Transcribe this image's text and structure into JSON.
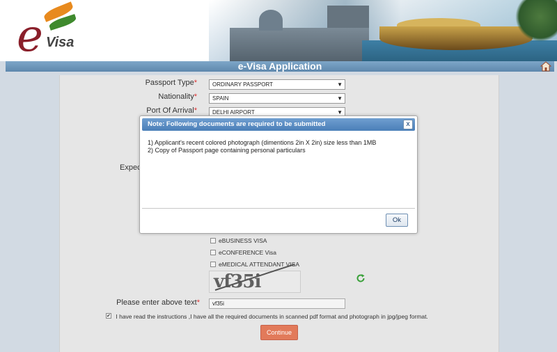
{
  "banner": {
    "logo_e": "e",
    "logo_visa": "Visa"
  },
  "header": {
    "title": "e-Visa Application"
  },
  "form": {
    "passport_type": {
      "label": "Passport Type",
      "value": "ORDINARY PASSPORT"
    },
    "nationality": {
      "label": "Nationality",
      "value": "SPAIN"
    },
    "port_of_arrival": {
      "label": "Port Of Arrival",
      "value": "DELHI AIRPORT"
    },
    "expected_label_partial": "Expect",
    "required_marker": "*",
    "visa_options": [
      {
        "label": "eBUSINESS VISA",
        "checked": false
      },
      {
        "label": "eCONFERENCE Visa",
        "checked": false
      },
      {
        "label": "eMEDICAL ATTENDANT VISA",
        "checked": false
      }
    ],
    "captcha_text": "vf35i",
    "captcha_prompt": "Please enter above text",
    "captcha_value": "vf35i",
    "declaration": "I have read the instructions ,I have all the required documents in scanned pdf format and photograph in jpg/jpeg format.",
    "declaration_checked": true,
    "continue_label": "Continue"
  },
  "modal": {
    "title": "Note: Following documents are required to be submitted",
    "close_label": "x",
    "items": [
      "1) Applicant's recent colored photograph (dimentions 2in X 2in) size less than 1MB",
      "2) Copy of Passport page containing personal particulars"
    ],
    "ok_label": "Ok"
  },
  "colors": {
    "title_bar": "#6b93b8",
    "continue_button": "#e27a5a",
    "modal_header": "#5a8cc4",
    "required": "#d33333"
  },
  "icons": {
    "home": "home-icon",
    "refresh": "refresh-icon",
    "close": "close-icon",
    "dropdown": "chevron-down-icon"
  }
}
